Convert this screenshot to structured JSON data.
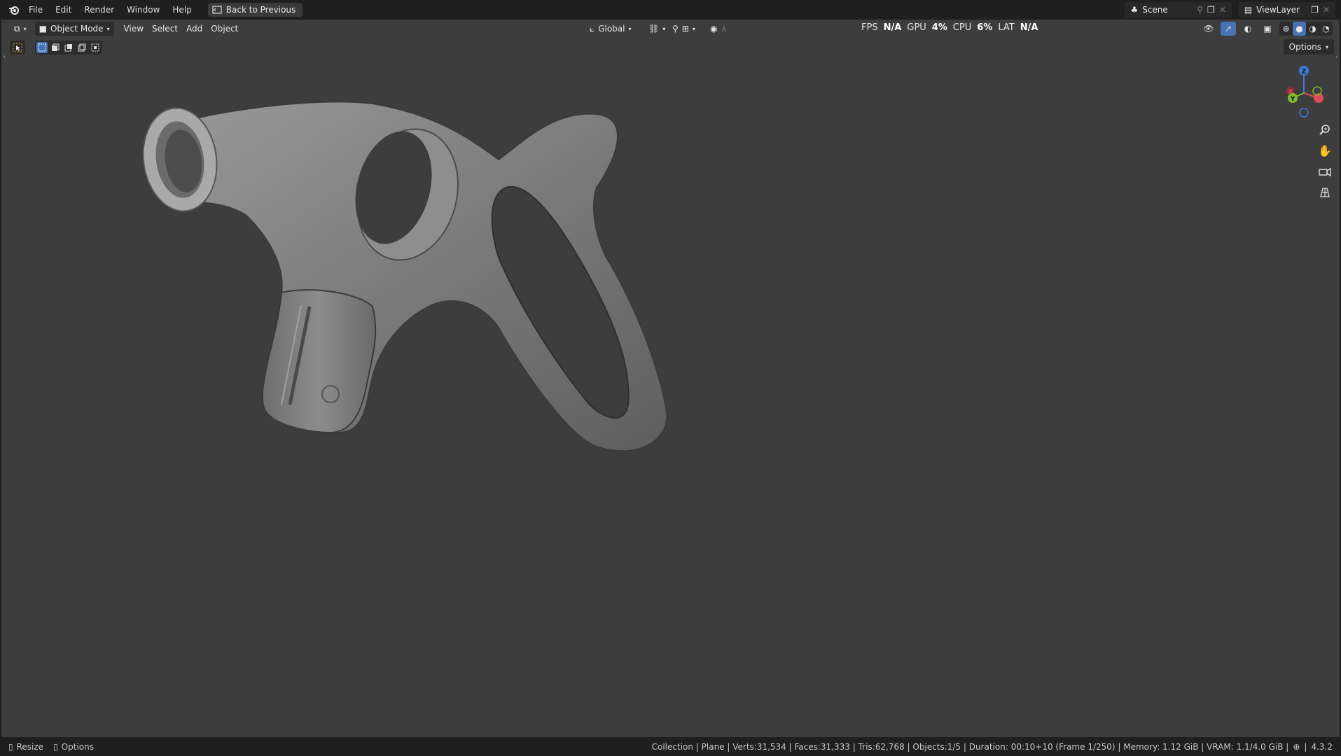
{
  "menubar": {
    "items": [
      "File",
      "Edit",
      "Render",
      "Window",
      "Help"
    ],
    "back_button": "Back to Previous",
    "scene": "Scene",
    "view_layer": "ViewLayer"
  },
  "viewport_header": {
    "mode": "Object Mode",
    "menus": [
      "View",
      "Select",
      "Add",
      "Object"
    ],
    "transform_orientation": "Global",
    "options": "Options"
  },
  "perf": {
    "fps_label": "FPS",
    "fps_value": "N/A",
    "gpu_label": "GPU",
    "gpu_value": "4%",
    "cpu_label": "CPU",
    "cpu_value": "6%",
    "lat_label": "LAT",
    "lat_value": "N/A"
  },
  "gizmo": {
    "z": "Z",
    "y": "Y",
    "x": "X"
  },
  "statusbar": {
    "left": [
      "Resize",
      "Options"
    ],
    "info": "Collection | Plane | Verts:31,534 | Faces:31,333 | Tris:62,768 | Objects:1/5 | Duration: 00:10+10 (Frame 1/250) | Memory: 1.12 GiB | VRAM: 1.1/4.0 GiB |",
    "version": "4.3.2"
  },
  "colors": {
    "viewport_bg": "#3d3d3d",
    "header_bg": "#1f1f1f",
    "accent": "#4772b3",
    "axis_x": "#e04b5a",
    "axis_y": "#7dbb2a",
    "axis_z": "#3d7cde"
  }
}
